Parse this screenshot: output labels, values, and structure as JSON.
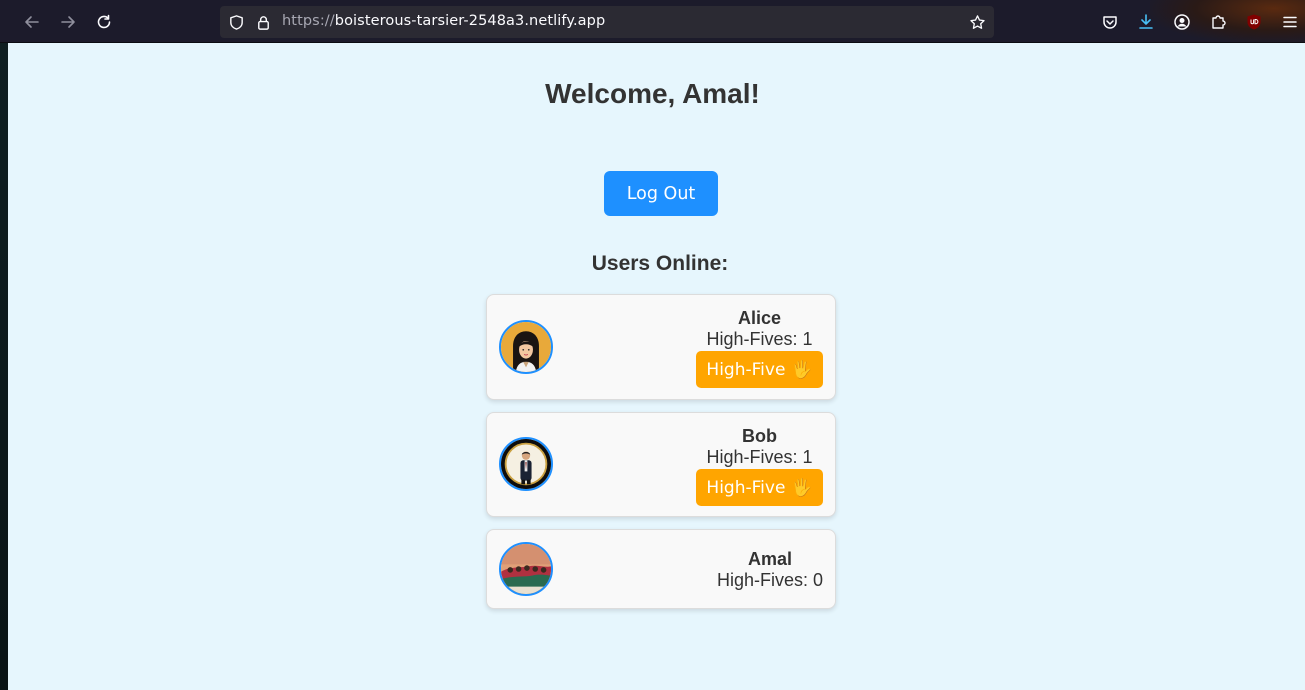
{
  "browser": {
    "url_scheme": "https://",
    "url_host": "boisterous-tarsier-2548a3.netlify.app"
  },
  "page": {
    "welcome": "Welcome, Amal!",
    "logout_label": "Log Out",
    "users_title": "Users Online:"
  },
  "users": [
    {
      "name": "Alice",
      "count_text": "High-Fives: 1",
      "button_label": "High-Five",
      "button_icon": "🖐"
    },
    {
      "name": "Bob",
      "count_text": "High-Fives: 1",
      "button_label": "High-Five",
      "button_icon": "🖐"
    },
    {
      "name": "Amal",
      "count_text": "High-Fives: 0"
    }
  ],
  "colors": {
    "page_bg": "#e6f6fd",
    "primary": "#1e90ff",
    "highfive": "#ffa500",
    "text": "#333333"
  }
}
